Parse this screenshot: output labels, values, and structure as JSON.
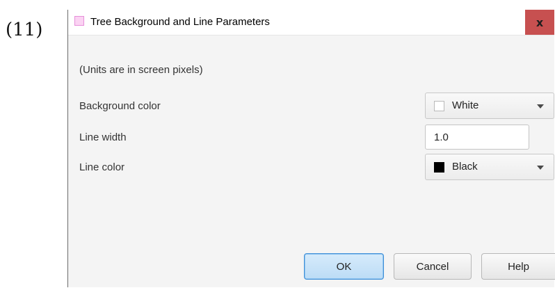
{
  "figure_label": "(11)",
  "window": {
    "title": "Tree Background and Line Parameters",
    "close_label": "x"
  },
  "form": {
    "units_note": "(Units are in screen pixels)",
    "background_color": {
      "label": "Background color",
      "value": "White",
      "swatch": "#ffffff"
    },
    "line_width": {
      "label": "Line width",
      "value": "1.0"
    },
    "line_color": {
      "label": "Line color",
      "value": "Black",
      "swatch": "#000000"
    }
  },
  "buttons": {
    "ok": "OK",
    "cancel": "Cancel",
    "help": "Help"
  }
}
